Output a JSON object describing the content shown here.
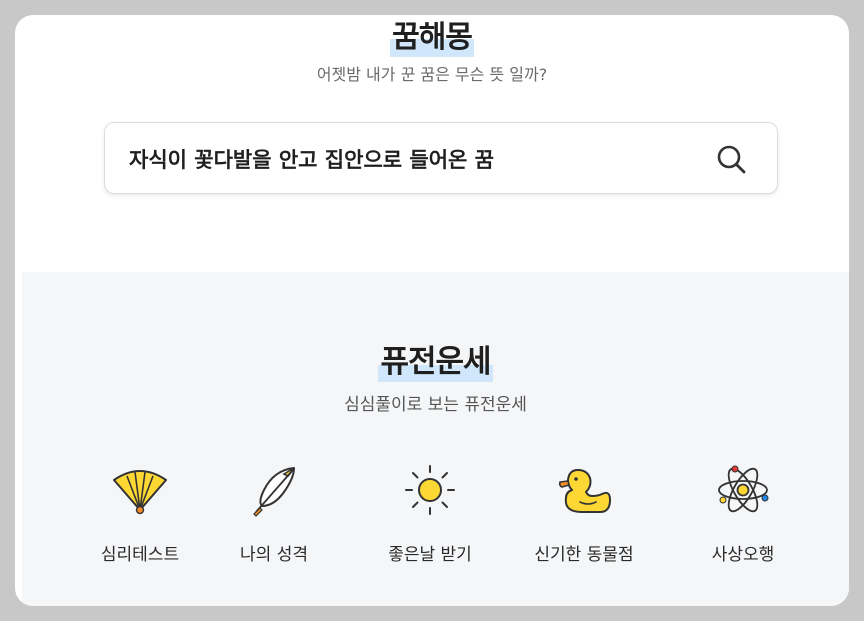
{
  "dream": {
    "title": "꿈해몽",
    "subtitle": "어젯밤 내가 꾼 꿈은 무슨 뜻 일까?",
    "search": {
      "value": "자식이 꽃다발을 안고 집안으로 들어온 꿈",
      "icon": "search-icon"
    }
  },
  "fortune": {
    "title": "퓨전운세",
    "subtitle": "심심풀이로 보는 퓨전운세",
    "items": [
      {
        "label": "심리테스트",
        "icon": "fan-icon"
      },
      {
        "label": "나의 성격",
        "icon": "feather-icon"
      },
      {
        "label": "좋은날 받기",
        "icon": "sun-icon"
      },
      {
        "label": "신기한 동물점",
        "icon": "duck-icon"
      },
      {
        "label": "사상오행",
        "icon": "atom-icon"
      }
    ]
  },
  "colors": {
    "highlight": "#cfe6fb",
    "icon_yellow": "#fdd835",
    "background": "#c8c8c8",
    "section_bg": "#f5f6f8"
  }
}
